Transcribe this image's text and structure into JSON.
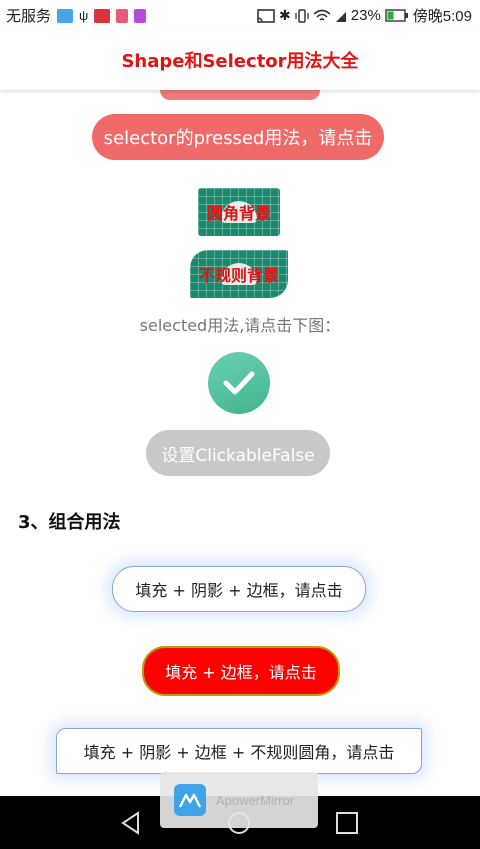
{
  "status_bar": {
    "carrier": "无服务",
    "battery": "23%",
    "time": "傍晚5:09",
    "icons": [
      "mirror-icon",
      "usb-icon",
      "huawei-icon",
      "app-icon",
      "app-icon",
      "cast-icon",
      "bluetooth-icon",
      "vibrate-icon",
      "wifi-icon",
      "sim-icon",
      "battery-icon"
    ]
  },
  "title_bar": {
    "title": "Shape和Selector用法大全"
  },
  "content": {
    "pressed_button": "selector的pressed用法，请点击",
    "tile_round": "圆角背景",
    "tile_irregular": "不规则背景",
    "selected_hint": "selected用法,请点击下图：",
    "clickable_false_button": "设置ClickableFalse",
    "section_title": "3、组合用法",
    "combo_fill_shadow_border": "填充 + 阴影 + 边框，请点击",
    "combo_fill_border": "填充 + 边框，请点击",
    "combo_fill_shadow_border_irregular": "填充 + 阴影 + 边框 + 不规则圆角，请点击"
  },
  "overlay": {
    "label": "ApowerMirror"
  },
  "nav_bar": {
    "buttons": [
      "back-icon",
      "home-icon",
      "recents-icon"
    ]
  },
  "colors": {
    "title": "#e01414",
    "pressed_button": "#f06a6a",
    "tile": "#1b8a6f",
    "check": "#54c3a0",
    "disabled": "#c8c8c8",
    "combo_red": "#ff0000",
    "border_blue": "#8aa6d8"
  }
}
